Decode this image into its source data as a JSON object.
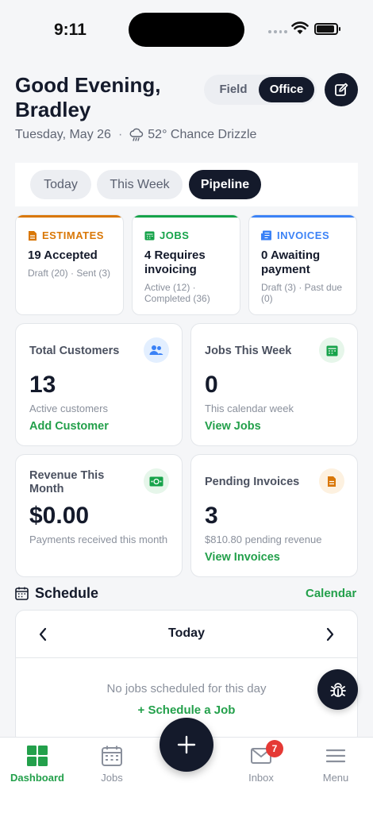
{
  "status_bar": {
    "time": "9:11"
  },
  "header": {
    "greeting": "Good Evening, Bradley",
    "mode_toggle": {
      "options": [
        "Field",
        "Office"
      ],
      "selected": "Office"
    },
    "date": "Tuesday, May 26",
    "weather": "52° Chance Drizzle"
  },
  "tabs": [
    {
      "label": "Today",
      "active": false
    },
    {
      "label": "This Week",
      "active": false
    },
    {
      "label": "Pipeline",
      "active": true
    }
  ],
  "pipeline": [
    {
      "title": "ESTIMATES",
      "value": "19 Accepted",
      "sub": "Draft (20) · Sent (3)",
      "color": "#d97706",
      "icon": "document-icon"
    },
    {
      "title": "JOBS",
      "value": "4 Requires invoicing",
      "sub": "Active (12) · Completed (36)",
      "color": "#16a34a",
      "icon": "calendar-icon"
    },
    {
      "title": "INVOICES",
      "value": "0 Awaiting payment",
      "sub": "Draft (3) · Past due (0)",
      "color": "#3b82f6",
      "icon": "receipt-icon"
    }
  ],
  "stats": {
    "customers": {
      "label": "Total Customers",
      "value": "13",
      "desc": "Active customers",
      "link": "Add Customer"
    },
    "jobs_week": {
      "label": "Jobs This Week",
      "value": "0",
      "desc": "This calendar week",
      "link": "View Jobs"
    },
    "revenue": {
      "label": "Revenue This Month",
      "value": "$0.00",
      "desc": "Payments received this month"
    },
    "pending": {
      "label": "Pending Invoices",
      "value": "3",
      "desc": "$810.80 pending revenue",
      "link": "View Invoices"
    }
  },
  "schedule": {
    "title": "Schedule",
    "calendar_link": "Calendar",
    "day": "Today",
    "empty": "No jobs scheduled for this day",
    "cta": "+ Schedule a Job"
  },
  "nav": {
    "items": [
      "Dashboard",
      "Jobs",
      "Inbox",
      "Menu"
    ],
    "active": "Dashboard",
    "inbox_badge": "7"
  },
  "colors": {
    "accent": "#23a04b",
    "dark": "#141a2b",
    "badge": "#e53935"
  }
}
